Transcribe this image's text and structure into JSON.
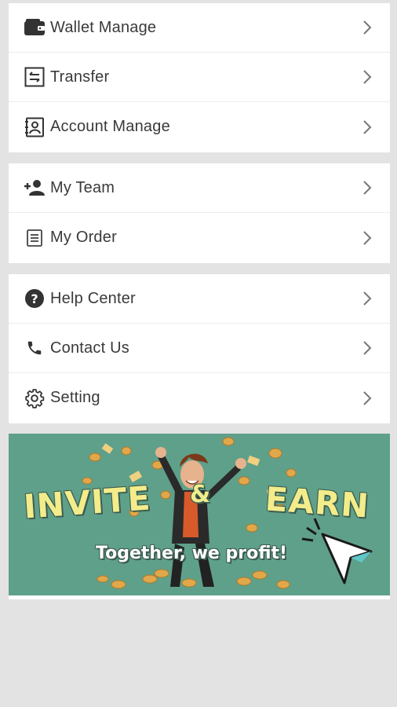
{
  "menu": {
    "group1": [
      {
        "label": "Wallet Manage",
        "icon": "wallet-icon"
      },
      {
        "label": "Transfer",
        "icon": "transfer-icon"
      },
      {
        "label": "Account Manage",
        "icon": "account-icon"
      }
    ],
    "group2": [
      {
        "label": "My Team",
        "icon": "add-person-icon"
      },
      {
        "label": "My Order",
        "icon": "order-list-icon"
      }
    ],
    "group3": [
      {
        "label": "Help Center",
        "icon": "help-icon"
      },
      {
        "label": "Contact Us",
        "icon": "phone-icon"
      },
      {
        "label": "Setting",
        "icon": "gear-icon"
      }
    ]
  },
  "banner": {
    "word1": "INVITE",
    "word2": "&",
    "word3": "EARN",
    "tagline": "Together, we profit!"
  },
  "colors": {
    "background": "#e3e3e3",
    "card": "#ffffff",
    "banner_bg": "#5fa08a",
    "banner_text": "#f2ec8a"
  }
}
